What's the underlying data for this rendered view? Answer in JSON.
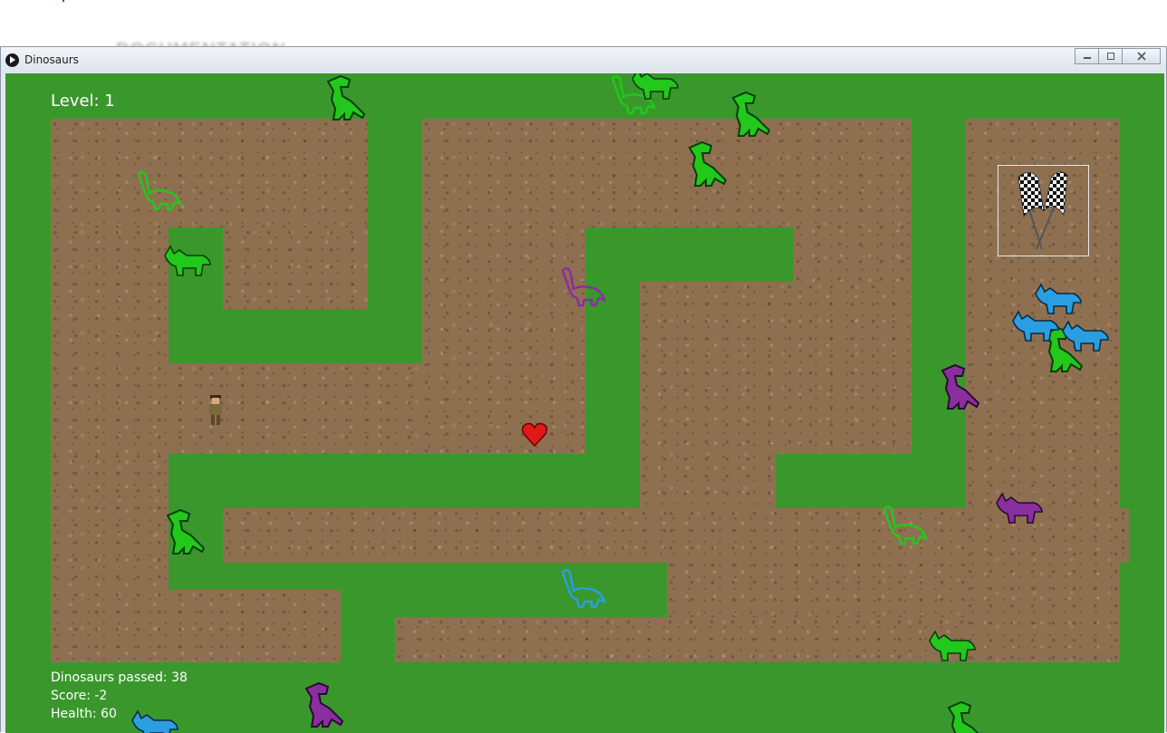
{
  "window": {
    "title": "Dinosaurs",
    "background_text": "DOCUMENTATION",
    "controls": {
      "minimize": "minimize-icon",
      "maximize": "maximize-icon",
      "close": "close-icon"
    }
  },
  "hud": {
    "level": "Level: 1",
    "dinosaurs_passed": "Dinosaurs passed: 38",
    "score": "Score: -2",
    "health": "Health: 60"
  },
  "colors": {
    "grass": "#3a972c",
    "dirt": "#8e7051",
    "green_dino": "#22c81c",
    "purple_dino": "#8a2f9e",
    "blue_dino": "#2a9ee0",
    "heart": "#e01818"
  },
  "sprites": {
    "player": "explorer-icon",
    "goal": "checkered-flags-icon",
    "pickup": "heart-icon",
    "dino_kinds": [
      "t-rex",
      "brontosaurus",
      "triceratops"
    ]
  }
}
